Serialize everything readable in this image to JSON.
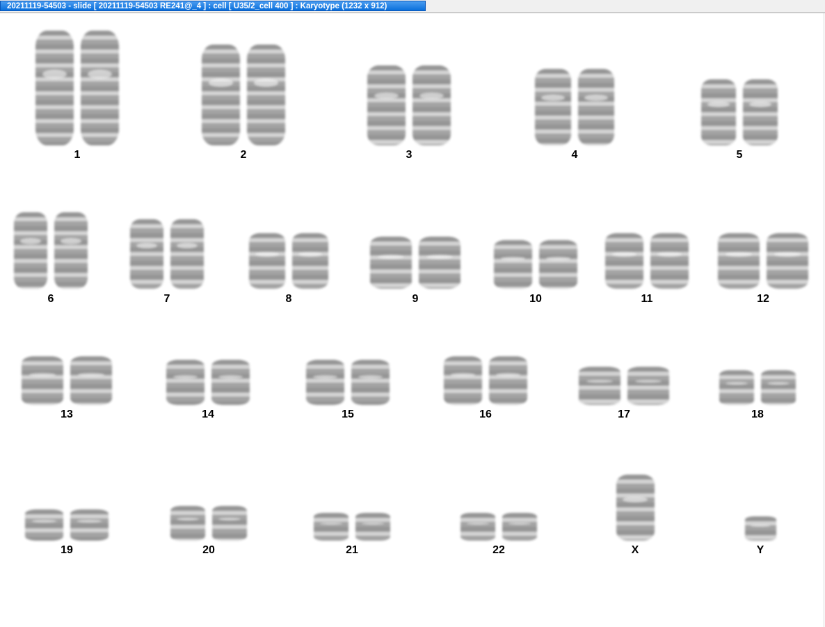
{
  "window": {
    "title": "20211119-54503 - slide [ 20211119-54503 RE241@_4 ] : cell [ U35/2_cell 400 ] : Karyotype  (1232 x 912)"
  },
  "karyotype": {
    "labels": [
      "1",
      "2",
      "3",
      "4",
      "5",
      "6",
      "7",
      "8",
      "9",
      "10",
      "11",
      "12",
      "13",
      "14",
      "15",
      "16",
      "17",
      "18",
      "19",
      "20",
      "21",
      "22",
      "X",
      "Y"
    ]
  },
  "colors": {
    "title_bar": "#0a6fdc",
    "title_text": "#ffffff",
    "background": "#ffffff",
    "chromosome": "#4a4a4a"
  }
}
